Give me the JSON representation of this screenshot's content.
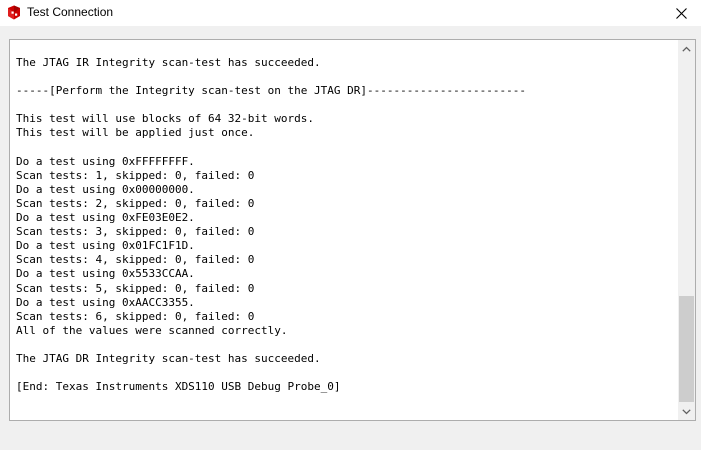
{
  "window": {
    "title": "Test Connection",
    "app_icon": "ti-logo-icon",
    "close_icon": "close-icon"
  },
  "output": {
    "lines": [
      "The JTAG IR Integrity scan-test has succeeded.",
      "",
      "-----[Perform the Integrity scan-test on the JTAG DR]------------------------",
      "",
      "This test will use blocks of 64 32-bit words.",
      "This test will be applied just once.",
      "",
      "Do a test using 0xFFFFFFFF.",
      "Scan tests: 1, skipped: 0, failed: 0",
      "Do a test using 0x00000000.",
      "Scan tests: 2, skipped: 0, failed: 0",
      "Do a test using 0xFE03E0E2.",
      "Scan tests: 3, skipped: 0, failed: 0",
      "Do a test using 0x01FC1F1D.",
      "Scan tests: 4, skipped: 0, failed: 0",
      "Do a test using 0x5533CCAA.",
      "Scan tests: 5, skipped: 0, failed: 0",
      "Do a test using 0xAACC3355.",
      "Scan tests: 6, skipped: 0, failed: 0",
      "All of the values were scanned correctly.",
      "",
      "The JTAG DR Integrity scan-test has succeeded.",
      "",
      "[End: Texas Instruments XDS110 USB Debug Probe_0]"
    ]
  },
  "scrollbar": {
    "up_icon": "chevron-up-icon",
    "down_icon": "chevron-down-icon",
    "scroll_position": 1.0
  },
  "colors": {
    "accent": "#cc0000",
    "background": "#f0f0f0"
  }
}
